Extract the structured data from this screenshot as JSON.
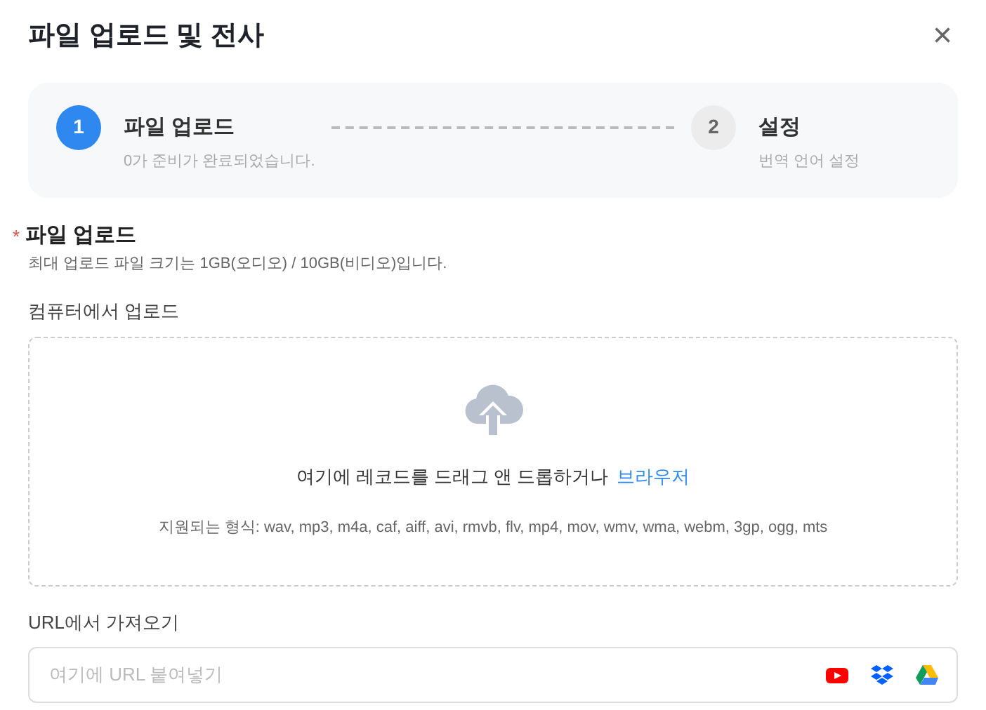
{
  "window": {
    "title": "파일 업로드 및 전사",
    "close": "×"
  },
  "steps": [
    {
      "number": "1",
      "title": "파일 업로드",
      "subtitle": "0가 준비가 완료되었습니다.",
      "selected": true
    },
    {
      "number": "2",
      "title": "설정",
      "subtitle": "번역 언어 설정",
      "selected": false
    }
  ],
  "upload": {
    "required_mark": "*",
    "title": "파일 업로드",
    "hint": "최대 업로드 파일 크기는 1GB(오디오) / 10GB(비디오)입니다.",
    "label": "컴퓨터에서 업로드",
    "drop_text": "여기에 레코드를 드래그 앤 드롭하거나",
    "browse_link": "브라우저",
    "formats": "지원되는 형식: wav, mp3, m4a, caf, aiff, avi, rmvb, flv, mp4, mov, wmv, wma, webm, 3gp, ogg, mts"
  },
  "url": {
    "label": "URL에서 가져오기",
    "placeholder": "여기에 URL 붙여넣기"
  }
}
